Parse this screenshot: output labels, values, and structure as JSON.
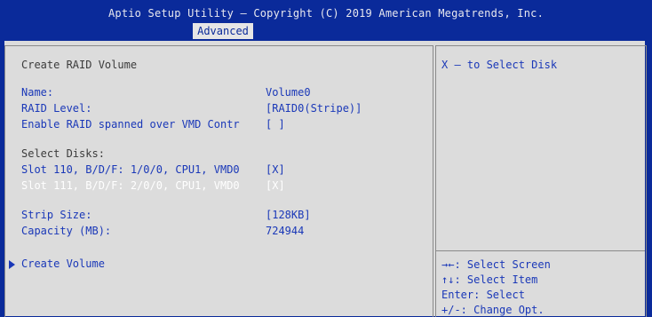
{
  "header": {
    "title": "Aptio Setup Utility – Copyright (C) 2019 American Megatrends, Inc.",
    "tab": "Advanced"
  },
  "page": {
    "heading": "Create RAID Volume"
  },
  "settings": [
    {
      "label": "Name:",
      "value": "Volume0"
    },
    {
      "label": "RAID Level:",
      "value": "[RAID0(Stripe)]"
    },
    {
      "label": "Enable RAID spanned over VMD Contr",
      "value": "[ ]"
    }
  ],
  "disks": {
    "heading": "Select Disks:",
    "items": [
      {
        "label": "Slot 110, B/D/F: 1/0/0, CPU1, VMD0",
        "value": "[X]"
      },
      {
        "label": "Slot 111, B/D/F: 2/0/0, CPU1, VMD0",
        "value": "[X]"
      }
    ]
  },
  "size": [
    {
      "label": "Strip Size:",
      "value": "[128KB]"
    },
    {
      "label": "Capacity (MB):",
      "value": "724944"
    }
  ],
  "action": {
    "label": "Create Volume"
  },
  "help": {
    "description": "X – to Select Disk",
    "keys": [
      "→←: Select Screen",
      "↑↓: Select Item",
      "Enter: Select",
      "+/-: Change Opt."
    ]
  },
  "colors": {
    "background": "#0a2a9a",
    "panel": "#dcdcdc",
    "highlight_text": "#ffffff",
    "item_text": "#1a38b8",
    "static_text": "#3b3b3b"
  }
}
